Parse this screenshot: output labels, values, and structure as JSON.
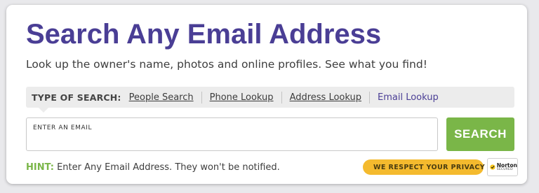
{
  "header": {
    "title": "Search Any Email Address",
    "subtitle": "Look up the owner's name, photos and online profiles. See what you find!"
  },
  "search_type": {
    "label": "TYPE OF SEARCH:",
    "options": [
      {
        "label": "People Search",
        "active": false
      },
      {
        "label": "Phone Lookup",
        "active": false
      },
      {
        "label": "Address Lookup",
        "active": false
      },
      {
        "label": "Email Lookup",
        "active": true
      }
    ]
  },
  "email_field": {
    "label": "ENTER AN EMAIL",
    "value": "",
    "placeholder": ""
  },
  "search_button": {
    "label": "SEARCH"
  },
  "hint": {
    "label": "HINT:",
    "text": "Enter Any Email Address. They won't be notified."
  },
  "privacy_badge": {
    "text": "WE RESPECT YOUR PRIVACY",
    "icon": "lock-icon"
  },
  "norton_badge": {
    "name": "Norton",
    "secured": "SECURED",
    "icon": "checkmark-icon"
  },
  "colors": {
    "title": "#4a3e95",
    "accent_green": "#7ab648",
    "privacy_badge": "#f4ba2e",
    "type_bar_bg": "#ececec",
    "norton_yellow": "#f6c51b"
  }
}
